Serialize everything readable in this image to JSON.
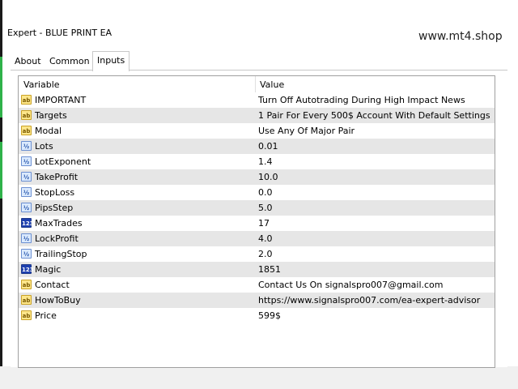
{
  "window": {
    "title": "Expert - BLUE PRINT EA",
    "watermark": "www.mt4.shop"
  },
  "tabs": [
    {
      "label": "About",
      "active": false
    },
    {
      "label": "Common",
      "active": false
    },
    {
      "label": "Inputs",
      "active": true
    }
  ],
  "table": {
    "columns": [
      "Variable",
      "Value"
    ],
    "rows": [
      {
        "type": "ab",
        "icon": "string-icon",
        "name": "IMPORTANT",
        "value": "Turn Off Autotrading During High Impact News"
      },
      {
        "type": "ab",
        "icon": "string-icon",
        "name": "Targets",
        "value": "1 Pair For Every 500$ Account With Default Settings"
      },
      {
        "type": "ab",
        "icon": "string-icon",
        "name": "Modal",
        "value": "Use Any Of Major Pair"
      },
      {
        "type": "dbl",
        "icon": "double-icon",
        "name": "Lots",
        "value": "0.01"
      },
      {
        "type": "dbl",
        "icon": "double-icon",
        "name": "LotExponent",
        "value": "1.4"
      },
      {
        "type": "dbl",
        "icon": "double-icon",
        "name": "TakeProfit",
        "value": "10.0"
      },
      {
        "type": "dbl",
        "icon": "double-icon",
        "name": "StopLoss",
        "value": "0.0"
      },
      {
        "type": "dbl",
        "icon": "double-icon",
        "name": "PipsStep",
        "value": "5.0"
      },
      {
        "type": "int",
        "icon": "integer-icon",
        "name": "MaxTrades",
        "value": "17"
      },
      {
        "type": "dbl",
        "icon": "double-icon",
        "name": "LockProfit",
        "value": "4.0"
      },
      {
        "type": "dbl",
        "icon": "double-icon",
        "name": "TrailingStop",
        "value": "2.0"
      },
      {
        "type": "int",
        "icon": "integer-icon",
        "name": "Magic",
        "value": "1851"
      },
      {
        "type": "ab",
        "icon": "string-icon",
        "name": "Contact",
        "value": "Contact Us On signalspro007@gmail.com"
      },
      {
        "type": "ab",
        "icon": "string-icon",
        "name": "HowToBuy",
        "value": "https://www.signalspro007.com/ea-expert-advisor"
      },
      {
        "type": "ab",
        "icon": "string-icon",
        "name": "Price",
        "value": "599$"
      }
    ]
  },
  "icon_glyphs": {
    "ab": "ab",
    "dbl": "½",
    "int": "123"
  },
  "colors": {
    "alt_row": "#e6e6e6",
    "accent_green": "#2fb24a"
  }
}
